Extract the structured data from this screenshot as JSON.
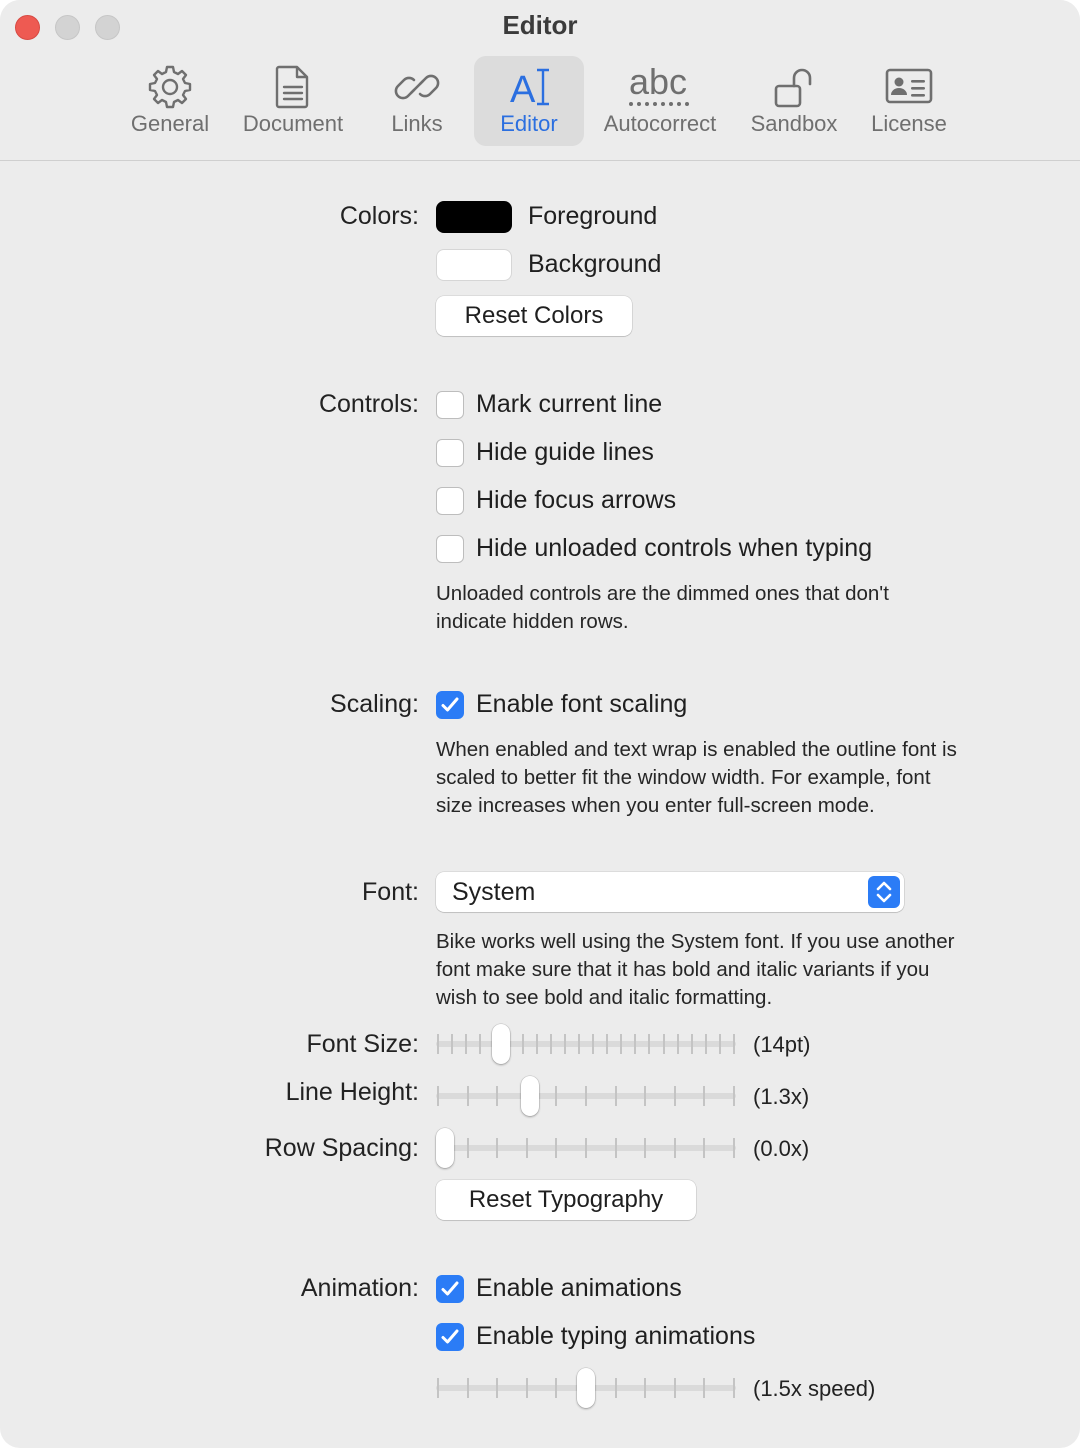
{
  "window": {
    "title": "Editor"
  },
  "tabs": [
    {
      "label": "General",
      "icon": "gear-icon"
    },
    {
      "label": "Document",
      "icon": "document-icon"
    },
    {
      "label": "Links",
      "icon": "link-icon"
    },
    {
      "label": "Editor",
      "icon": "text-cursor-icon",
      "icon_text": "A",
      "active": true
    },
    {
      "label": "Autocorrect",
      "icon": "abc-icon",
      "icon_text": "abc"
    },
    {
      "label": "Sandbox",
      "icon": "unlocked-icon"
    },
    {
      "label": "License",
      "icon": "id-card-icon"
    }
  ],
  "colors": {
    "label": "Colors:",
    "foreground_label": "Foreground",
    "foreground_color": "#000000",
    "background_label": "Background",
    "background_color": "#ffffff",
    "reset_label": "Reset Colors"
  },
  "controls": {
    "label": "Controls:",
    "options": [
      {
        "label": "Mark current line",
        "checked": false
      },
      {
        "label": "Hide guide lines",
        "checked": false
      },
      {
        "label": "Hide focus arrows",
        "checked": false
      },
      {
        "label": "Hide unloaded controls when typing",
        "checked": false
      }
    ],
    "note_line1": "Unloaded controls are the dimmed ones that don't",
    "note_line2": "indicate hidden rows."
  },
  "scaling": {
    "label": "Scaling:",
    "option_label": "Enable font scaling",
    "checked": true,
    "note_line1": "When enabled and text wrap is enabled the outline font is",
    "note_line2": "scaled to better fit the window width. For example, font",
    "note_line3": "size increases when you enter full-screen mode."
  },
  "font": {
    "label": "Font:",
    "value": "System",
    "note_line1": "Bike works well using the System font. If you use another",
    "note_line2": "font make sure that it has bold and italic variants if you",
    "note_line3": "wish to see bold and italic formatting."
  },
  "typography": {
    "font_size_label": "Font Size:",
    "font_size_value": "(14pt)",
    "font_size_level": 0.2,
    "line_height_label": "Line Height:",
    "line_height_value": "(1.3x)",
    "line_height_level": 0.3,
    "row_spacing_label": "Row Spacing:",
    "row_spacing_value": "(0.0x)",
    "row_spacing_level": 0.0,
    "reset_label": "Reset Typography"
  },
  "animation": {
    "label": "Animation:",
    "option1_label": "Enable animations",
    "option1_checked": true,
    "option2_label": "Enable typing animations",
    "option2_checked": true,
    "speed_value": "(1.5x speed)",
    "speed_level": 0.5
  }
}
